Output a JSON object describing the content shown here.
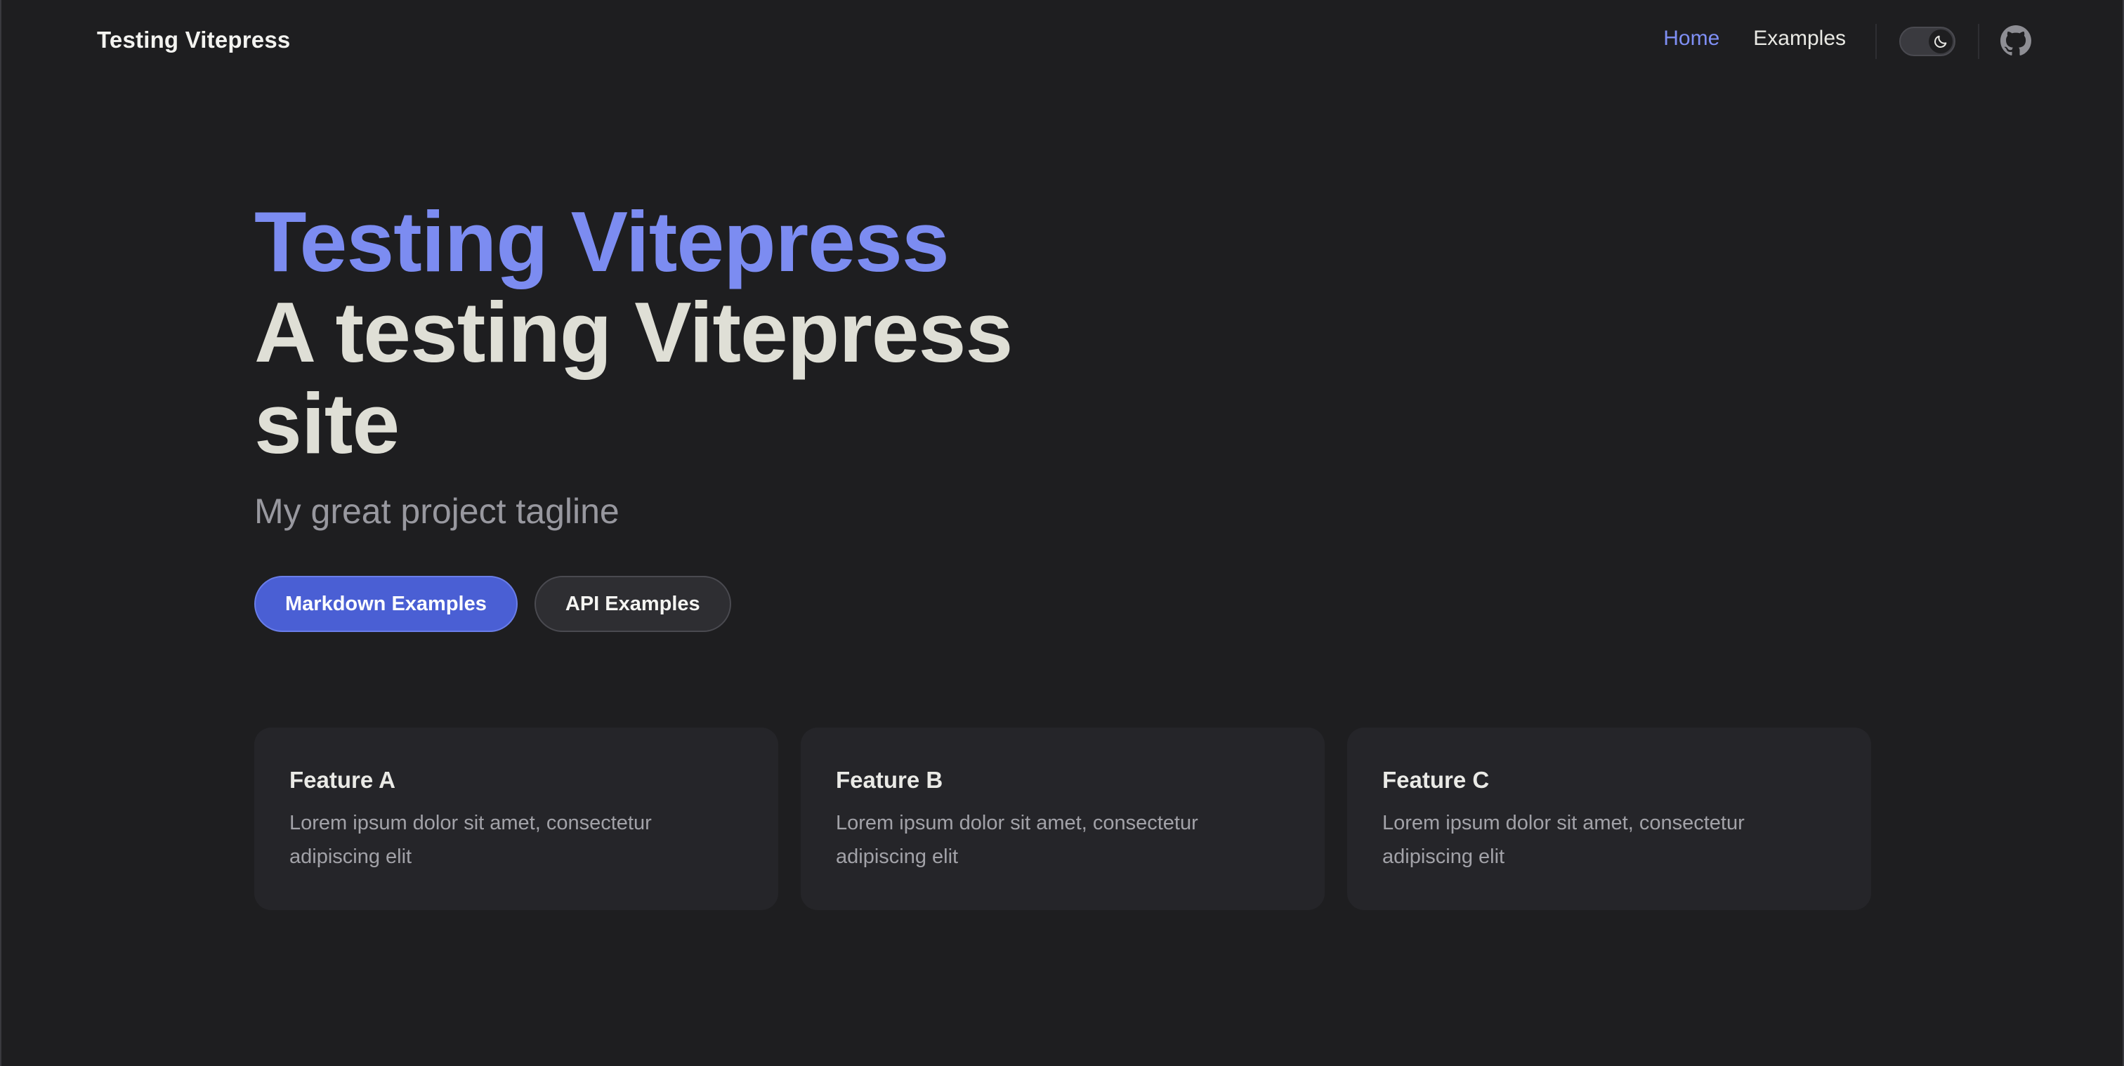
{
  "nav": {
    "site_title": "Testing Vitepress",
    "links": [
      {
        "label": "Home",
        "active": true
      },
      {
        "label": "Examples",
        "active": false
      }
    ],
    "appearance_toggle_icon": "moon-icon",
    "social_icon": "github-icon"
  },
  "hero": {
    "name": "Testing Vitepress",
    "text": "A testing Vitepress site",
    "tagline": "My great project tagline",
    "actions": [
      {
        "label": "Markdown Examples",
        "theme": "brand"
      },
      {
        "label": "API Examples",
        "theme": "alt"
      }
    ]
  },
  "features": [
    {
      "title": "Feature A",
      "details": "Lorem ipsum dolor sit amet, consectetur adipiscing elit"
    },
    {
      "title": "Feature B",
      "details": "Lorem ipsum dolor sit amet, consectetur adipiscing elit"
    },
    {
      "title": "Feature C",
      "details": "Lorem ipsum dolor sit amet, consectetur adipiscing elit"
    }
  ],
  "colors": {
    "background": "#1e1e20",
    "brand": "#7c8cf1",
    "brand_button": "#4a5fd4",
    "card": "#252529"
  }
}
